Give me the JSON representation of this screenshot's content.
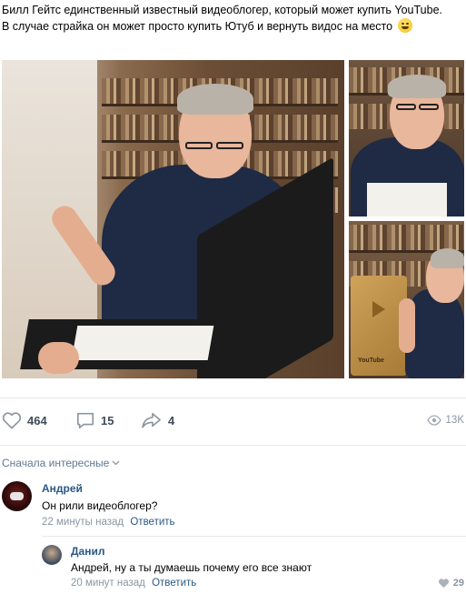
{
  "post": {
    "text_line1": "Билл Гейтс единственный известный видеоблогер, который может купить YouTube.",
    "text_line2": "В случае страйка он может просто купить Ютуб и вернуть видос на место",
    "emoji": "grinning-face-emoji"
  },
  "actions": {
    "likes": "464",
    "comments": "15",
    "shares": "4",
    "views": "13K"
  },
  "comments_section": {
    "sort_label": "Сначала интересные",
    "items": [
      {
        "author": "Андрей",
        "text": "Он рили видеоблогер?",
        "time": "22 минуты назад",
        "reply_label": "Ответить"
      },
      {
        "author": "Данил",
        "text": "Андрей, ну а ты думаешь почему его все знают",
        "time": "20 минут назад",
        "reply_label": "Ответить",
        "likes": "29"
      }
    ]
  },
  "photos": {
    "plaque_text": "YouTube"
  },
  "colors": {
    "link": "#2a5885",
    "action_text": "#3f4b59",
    "meta": "#8b96a3",
    "sort_link": "#5f7994"
  },
  "icons": [
    "heart-icon",
    "comment-icon",
    "share-icon",
    "eye-icon",
    "chevron-down-icon"
  ]
}
